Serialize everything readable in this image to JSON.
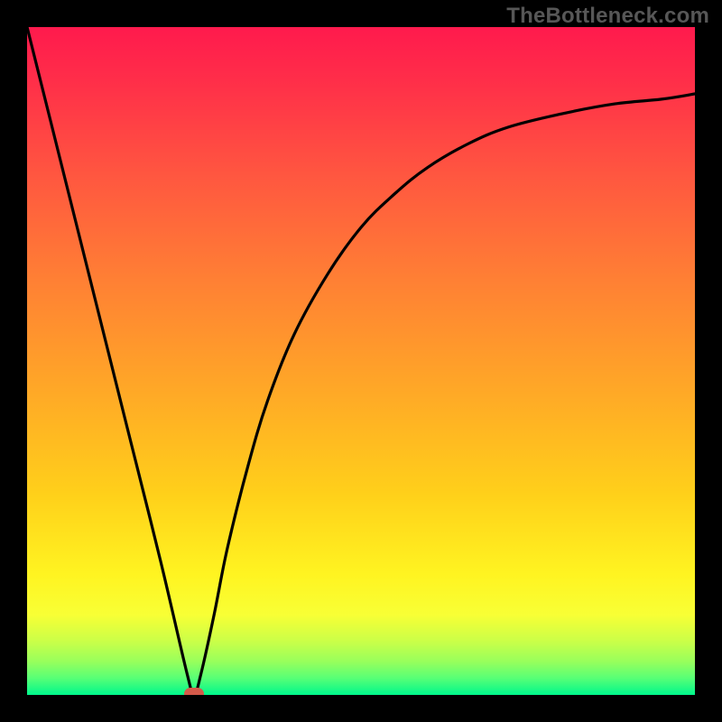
{
  "watermark": "TheBottleneck.com",
  "colors": {
    "frame_bg": "#000000",
    "curve_stroke": "#000000",
    "min_marker": "#d45a4a",
    "gradient_top": "#ff1a4d",
    "gradient_bottom": "#00f78c"
  },
  "chart_data": {
    "type": "line",
    "title": "",
    "xlabel": "",
    "ylabel": "",
    "xlim": [
      0,
      100
    ],
    "ylim": [
      0,
      100
    ],
    "grid": false,
    "legend": false,
    "note": "Axes unlabeled; values estimated from pixel positions on 0–100 scale.",
    "minimum": {
      "x": 25,
      "y": 0
    },
    "series": [
      {
        "name": "bottleneck-curve",
        "x": [
          0,
          5,
          10,
          15,
          20,
          24,
          25,
          26,
          28,
          30,
          33,
          36,
          40,
          45,
          50,
          55,
          60,
          66,
          72,
          80,
          88,
          95,
          100
        ],
        "values": [
          100,
          80,
          60,
          40,
          20,
          3,
          0,
          3,
          12,
          22,
          34,
          44,
          54,
          63,
          70,
          75,
          79,
          82.5,
          85,
          87,
          88.5,
          89.2,
          90
        ]
      }
    ],
    "marker": {
      "name": "minimum-point",
      "x": 25,
      "y": 0
    }
  }
}
